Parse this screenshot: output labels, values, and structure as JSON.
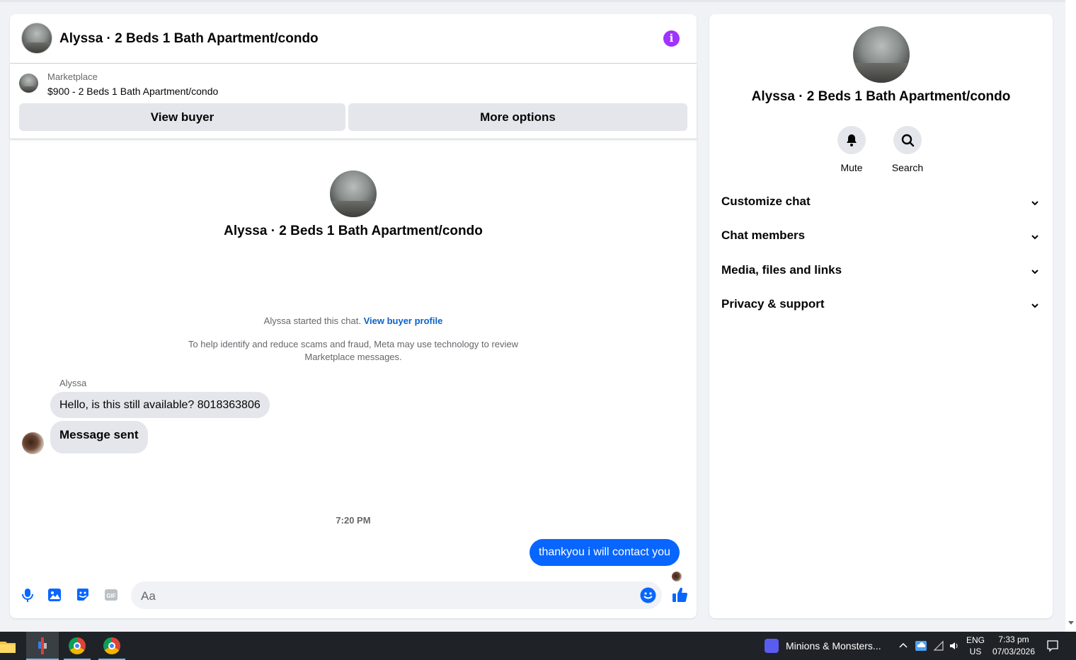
{
  "chat": {
    "header_title": "Alyssa · 2 Beds 1 Bath Apartment/condo",
    "marketplace_label": "Marketplace",
    "marketplace_listing": "$900 - 2 Beds 1 Bath Apartment/condo",
    "view_buyer_label": "View buyer",
    "more_options_label": "More options",
    "center_title": "Alyssa · 2 Beds 1 Bath Apartment/condo",
    "started_text": "Alyssa started this chat.",
    "view_buyer_profile": "View buyer profile",
    "disclaimer": "To help identify and reduce scams and fraud, Meta may use technology to review Marketplace messages.",
    "sender_name": "Alyssa",
    "messages_in": [
      {
        "text": "Hello, is this still available?  8018363806"
      },
      {
        "text": "Message sent"
      }
    ],
    "timestamp": "7:20 PM",
    "message_out": "thankyou i  will contact you",
    "composer_placeholder": "Aa"
  },
  "side": {
    "title": "Alyssa · 2 Beds 1 Bath Apartment/condo",
    "mute_label": "Mute",
    "search_label": "Search",
    "sections": [
      {
        "label": "Customize chat"
      },
      {
        "label": "Chat members"
      },
      {
        "label": "Media, files and links"
      },
      {
        "label": "Privacy & support"
      }
    ]
  },
  "taskbar": {
    "media_title": "Minions & Monsters...",
    "language": "ENG",
    "region": "US",
    "time": "7:33 pm",
    "date": "07/03/2026"
  },
  "colors": {
    "accent_blue": "#0866ff",
    "info_purple": "#a033ff",
    "link_blue": "#0a62ca"
  },
  "icons": [
    "info-icon",
    "microphone-icon",
    "image-icon",
    "sticker-icon",
    "gif-icon",
    "emoji-icon",
    "thumbs-up-icon",
    "bell-icon",
    "search-icon",
    "chevron-down-icon"
  ]
}
